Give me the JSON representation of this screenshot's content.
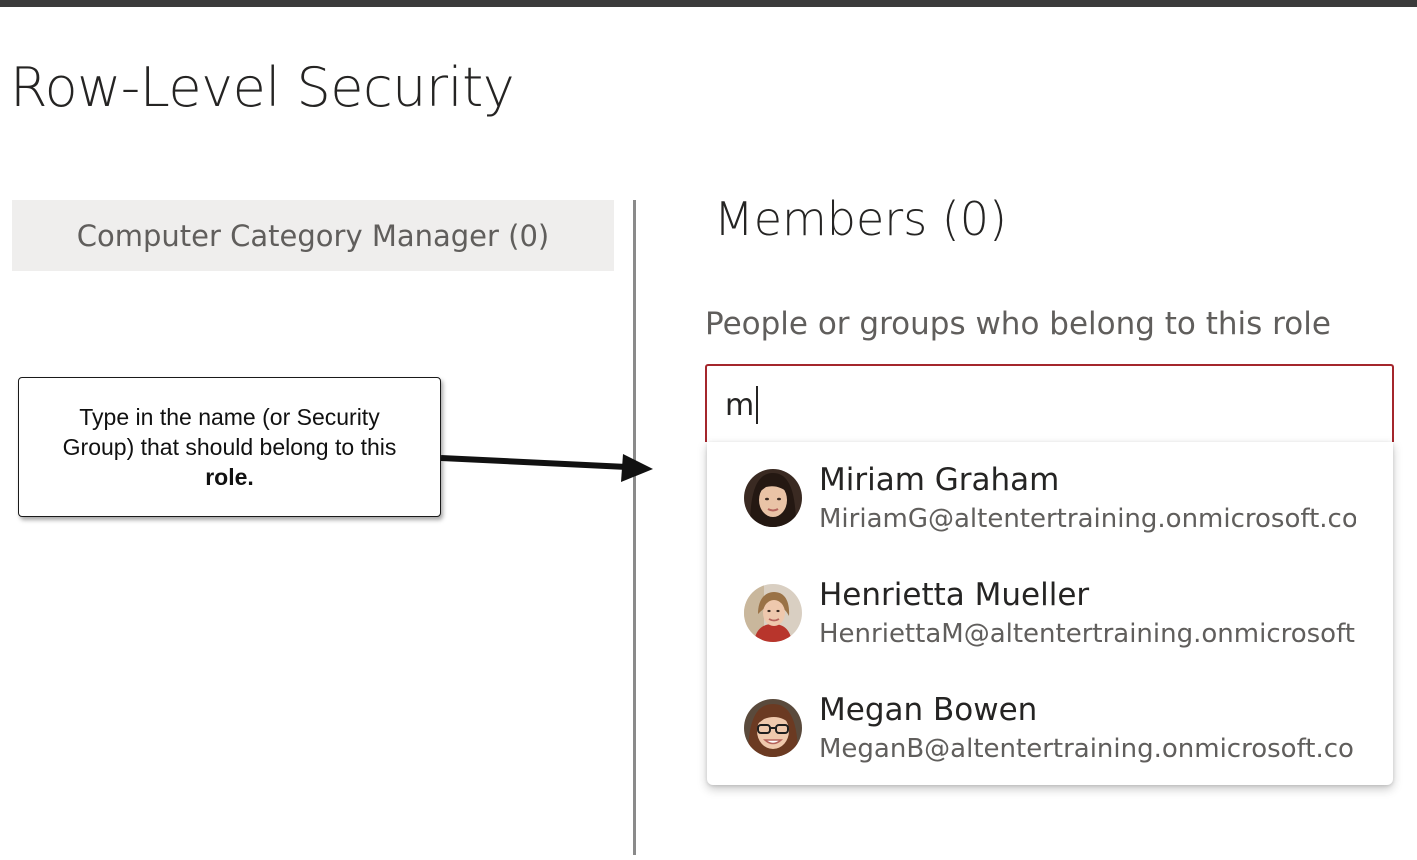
{
  "page": {
    "title": "Row-Level Security"
  },
  "roles": {
    "items": [
      {
        "label": "Computer Category Manager (0)"
      }
    ]
  },
  "members": {
    "title": "Members (0)",
    "field_label": "People or groups who belong to this role",
    "search_value": "m",
    "accent_color": "#a4262c",
    "suggestions": [
      {
        "name": "Miriam Graham",
        "email": "MiriamG@altentertraining.onmicrosoft.com",
        "avatar_icon": "person-avatar"
      },
      {
        "name": "Henrietta Mueller",
        "email": "HenriettaM@altentertraining.onmicrosoft.com",
        "avatar_icon": "person-avatar"
      },
      {
        "name": "Megan Bowen",
        "email": "MeganB@altentertraining.onmicrosoft.com",
        "avatar_icon": "person-avatar"
      }
    ]
  },
  "callout": {
    "text_line1": "Type in the name (or Security",
    "text_line2": "Group) that should belong to this",
    "text_bold": "role."
  }
}
